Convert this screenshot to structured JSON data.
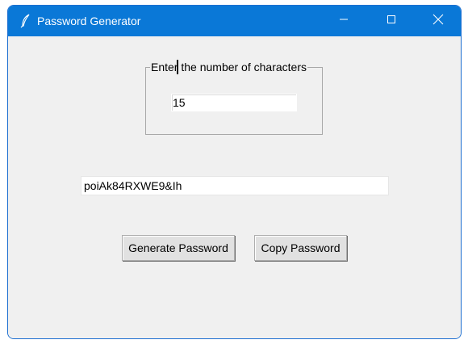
{
  "window": {
    "title": "Password Generator",
    "icon": "feather-icon",
    "controls": [
      "minimize-icon",
      "maximize-icon",
      "close-icon"
    ]
  },
  "length_group": {
    "label": "Enter the number of characters",
    "value": "15"
  },
  "password": {
    "value": "poiAk84RXWE9&Ih"
  },
  "buttons": {
    "generate_label": "Generate Password",
    "copy_label": "Copy Password"
  },
  "colors": {
    "titlebar": "#0a78d7",
    "window_bg": "#f0f0f0",
    "button_bg": "#e1e1e1"
  }
}
